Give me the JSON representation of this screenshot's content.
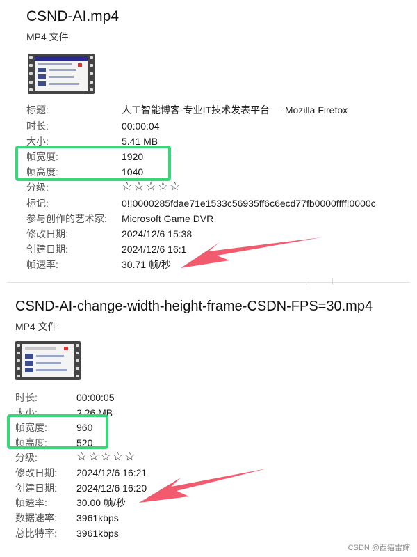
{
  "file1": {
    "title": "CSND-AI.mp4",
    "type": "MP4 文件",
    "props": [
      {
        "label": "标题:",
        "value": "人工智能博客-专业IT技术发表平台 — Mozilla Firefox"
      },
      {
        "label": "时长:",
        "value": "00:00:04"
      },
      {
        "label": "大小:",
        "value": "5.41 MB"
      },
      {
        "label": "帧宽度:",
        "value": "1920"
      },
      {
        "label": "帧高度:",
        "value": "1040"
      },
      {
        "label": "分级:",
        "value": "☆☆☆☆☆"
      },
      {
        "label": "标记:",
        "value": "0!!0000285fdae71e1533c56935ff6c6ecd77fb0000ffff!0000c"
      },
      {
        "label": "参与创作的艺术家:",
        "value": "Microsoft Game DVR"
      },
      {
        "label": "修改日期:",
        "value": "2024/12/6 15:38"
      },
      {
        "label": "创建日期:",
        "value": "2024/12/6 16:1"
      },
      {
        "label": "帧速率:",
        "value": "30.71 帧/秒"
      }
    ]
  },
  "file2": {
    "title": "CSND-AI-change-width-height-frame-CSDN-FPS=30.mp4",
    "type": "MP4 文件",
    "props": [
      {
        "label": "时长:",
        "value": "00:00:05"
      },
      {
        "label": "大小:",
        "value": "2.26 MB"
      },
      {
        "label": "帧宽度:",
        "value": "960"
      },
      {
        "label": "帧高度:",
        "value": "520"
      },
      {
        "label": "分级:",
        "value": "☆☆☆☆☆"
      },
      {
        "label": "修改日期:",
        "value": "2024/12/6 16:21"
      },
      {
        "label": "创建日期:",
        "value": "2024/12/6 16:20"
      },
      {
        "label": "帧速率:",
        "value": "30.00 帧/秒"
      },
      {
        "label": "数据速率:",
        "value": "3961kbps"
      },
      {
        "label": "总比特率:",
        "value": "3961kbps"
      }
    ]
  },
  "watermark": "CSDN @西猫雷婶",
  "colors": {
    "highlight_box": "#38d878",
    "arrow": "#f25a6e"
  }
}
